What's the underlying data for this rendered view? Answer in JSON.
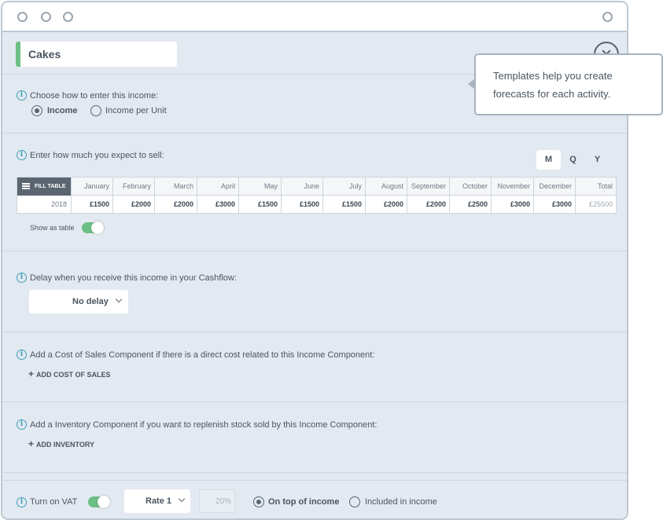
{
  "component": {
    "name": "Cakes"
  },
  "income_method": {
    "prompt": "Choose how to enter this income:",
    "options": [
      "Income",
      "Income per Unit"
    ],
    "selected": 0
  },
  "sales": {
    "prompt": "Enter how much you expect to sell:",
    "period_tabs": [
      "M",
      "Q",
      "Y"
    ],
    "selected_period": "M",
    "fill_table_label": "FILL TABLE",
    "columns": [
      "January",
      "February",
      "March",
      "April",
      "May",
      "June",
      "July",
      "August",
      "September",
      "October",
      "November",
      "December",
      "Total"
    ],
    "row": {
      "year": "2018",
      "values": [
        "£1500",
        "£2000",
        "£2000",
        "£3000",
        "£1500",
        "£1500",
        "£1500",
        "£2000",
        "£2000",
        "£2500",
        "£3000",
        "£3000",
        "£25500"
      ]
    },
    "show_as_table_label": "Show as table",
    "show_as_table": true
  },
  "delay": {
    "prompt": "Delay when you receive this income in your Cashflow:",
    "value": "No delay"
  },
  "cost_of_sales": {
    "prompt": "Add a Cost of Sales Component if there is a direct cost related to this Income Component:",
    "add_label": "ADD COST OF SALES"
  },
  "inventory": {
    "prompt": "Add a Inventory Component if you want to replenish stock sold by this Income Component:",
    "add_label": "ADD INVENTORY"
  },
  "vat": {
    "label": "Turn on VAT",
    "enabled": true,
    "rate": "Rate 1",
    "percent": "20%",
    "options": [
      "On top of income",
      "Included in income"
    ],
    "selected": 0
  },
  "tooltip": {
    "line1": "Templates help you create",
    "line2": "forecasts for each activity."
  },
  "colors": {
    "accent": "#6cbf84",
    "info": "#3d9fb8",
    "panel": "#e3e9f0",
    "border": "#bcc8d3"
  }
}
